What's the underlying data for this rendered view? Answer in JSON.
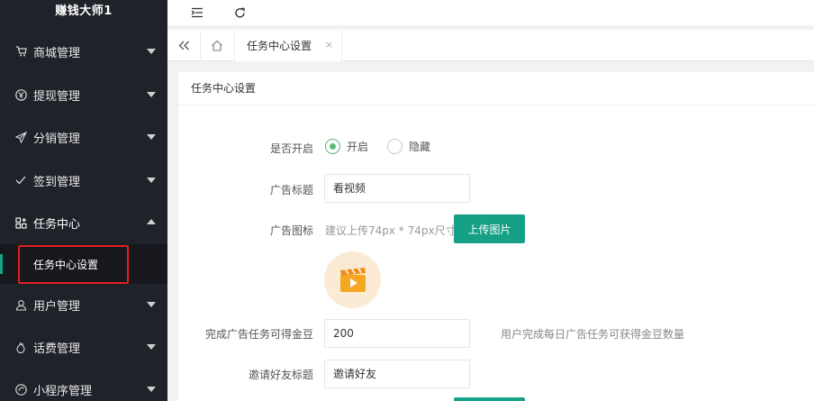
{
  "brand": {
    "title": "赚钱大师1"
  },
  "sidebar": {
    "items": [
      {
        "label": "商城管理",
        "icon": "cart-icon"
      },
      {
        "label": "提现管理",
        "icon": "yen-icon"
      },
      {
        "label": "分销管理",
        "icon": "send-icon"
      },
      {
        "label": "签到管理",
        "icon": "check-icon"
      },
      {
        "label": "任务中心",
        "icon": "grid-icon"
      },
      {
        "label": "用户管理",
        "icon": "user-icon"
      },
      {
        "label": "话费管理",
        "icon": "fire-icon"
      },
      {
        "label": "小程序管理",
        "icon": "miniapp-icon"
      }
    ],
    "sub_active": {
      "label": "任务中心设置"
    }
  },
  "tabs": {
    "active": {
      "label": "任务中心设置",
      "close": "×"
    }
  },
  "card": {
    "title": "任务中心设置",
    "fields": {
      "enabled": {
        "label": "是否开启",
        "option_on": "开启",
        "option_off": "隐藏",
        "selected": "开启"
      },
      "ad_title": {
        "label": "广告标题",
        "value": "看视频"
      },
      "ad_icon": {
        "label": "广告图标",
        "hint": "建议上传74px * 74px尺寸",
        "button": "上传图片"
      },
      "ad_coins": {
        "label": "完成广告任务可得金豆",
        "value": "200",
        "hint": "用户完成每日广告任务可获得金豆数量"
      },
      "invite_title": {
        "label": "邀请好友标题",
        "value": "邀请好友"
      }
    }
  },
  "colors": {
    "accent": "#16a085",
    "sidebar_bg": "#20222a",
    "radio_on": "#5fb878",
    "highlight_border": "#e02020"
  }
}
